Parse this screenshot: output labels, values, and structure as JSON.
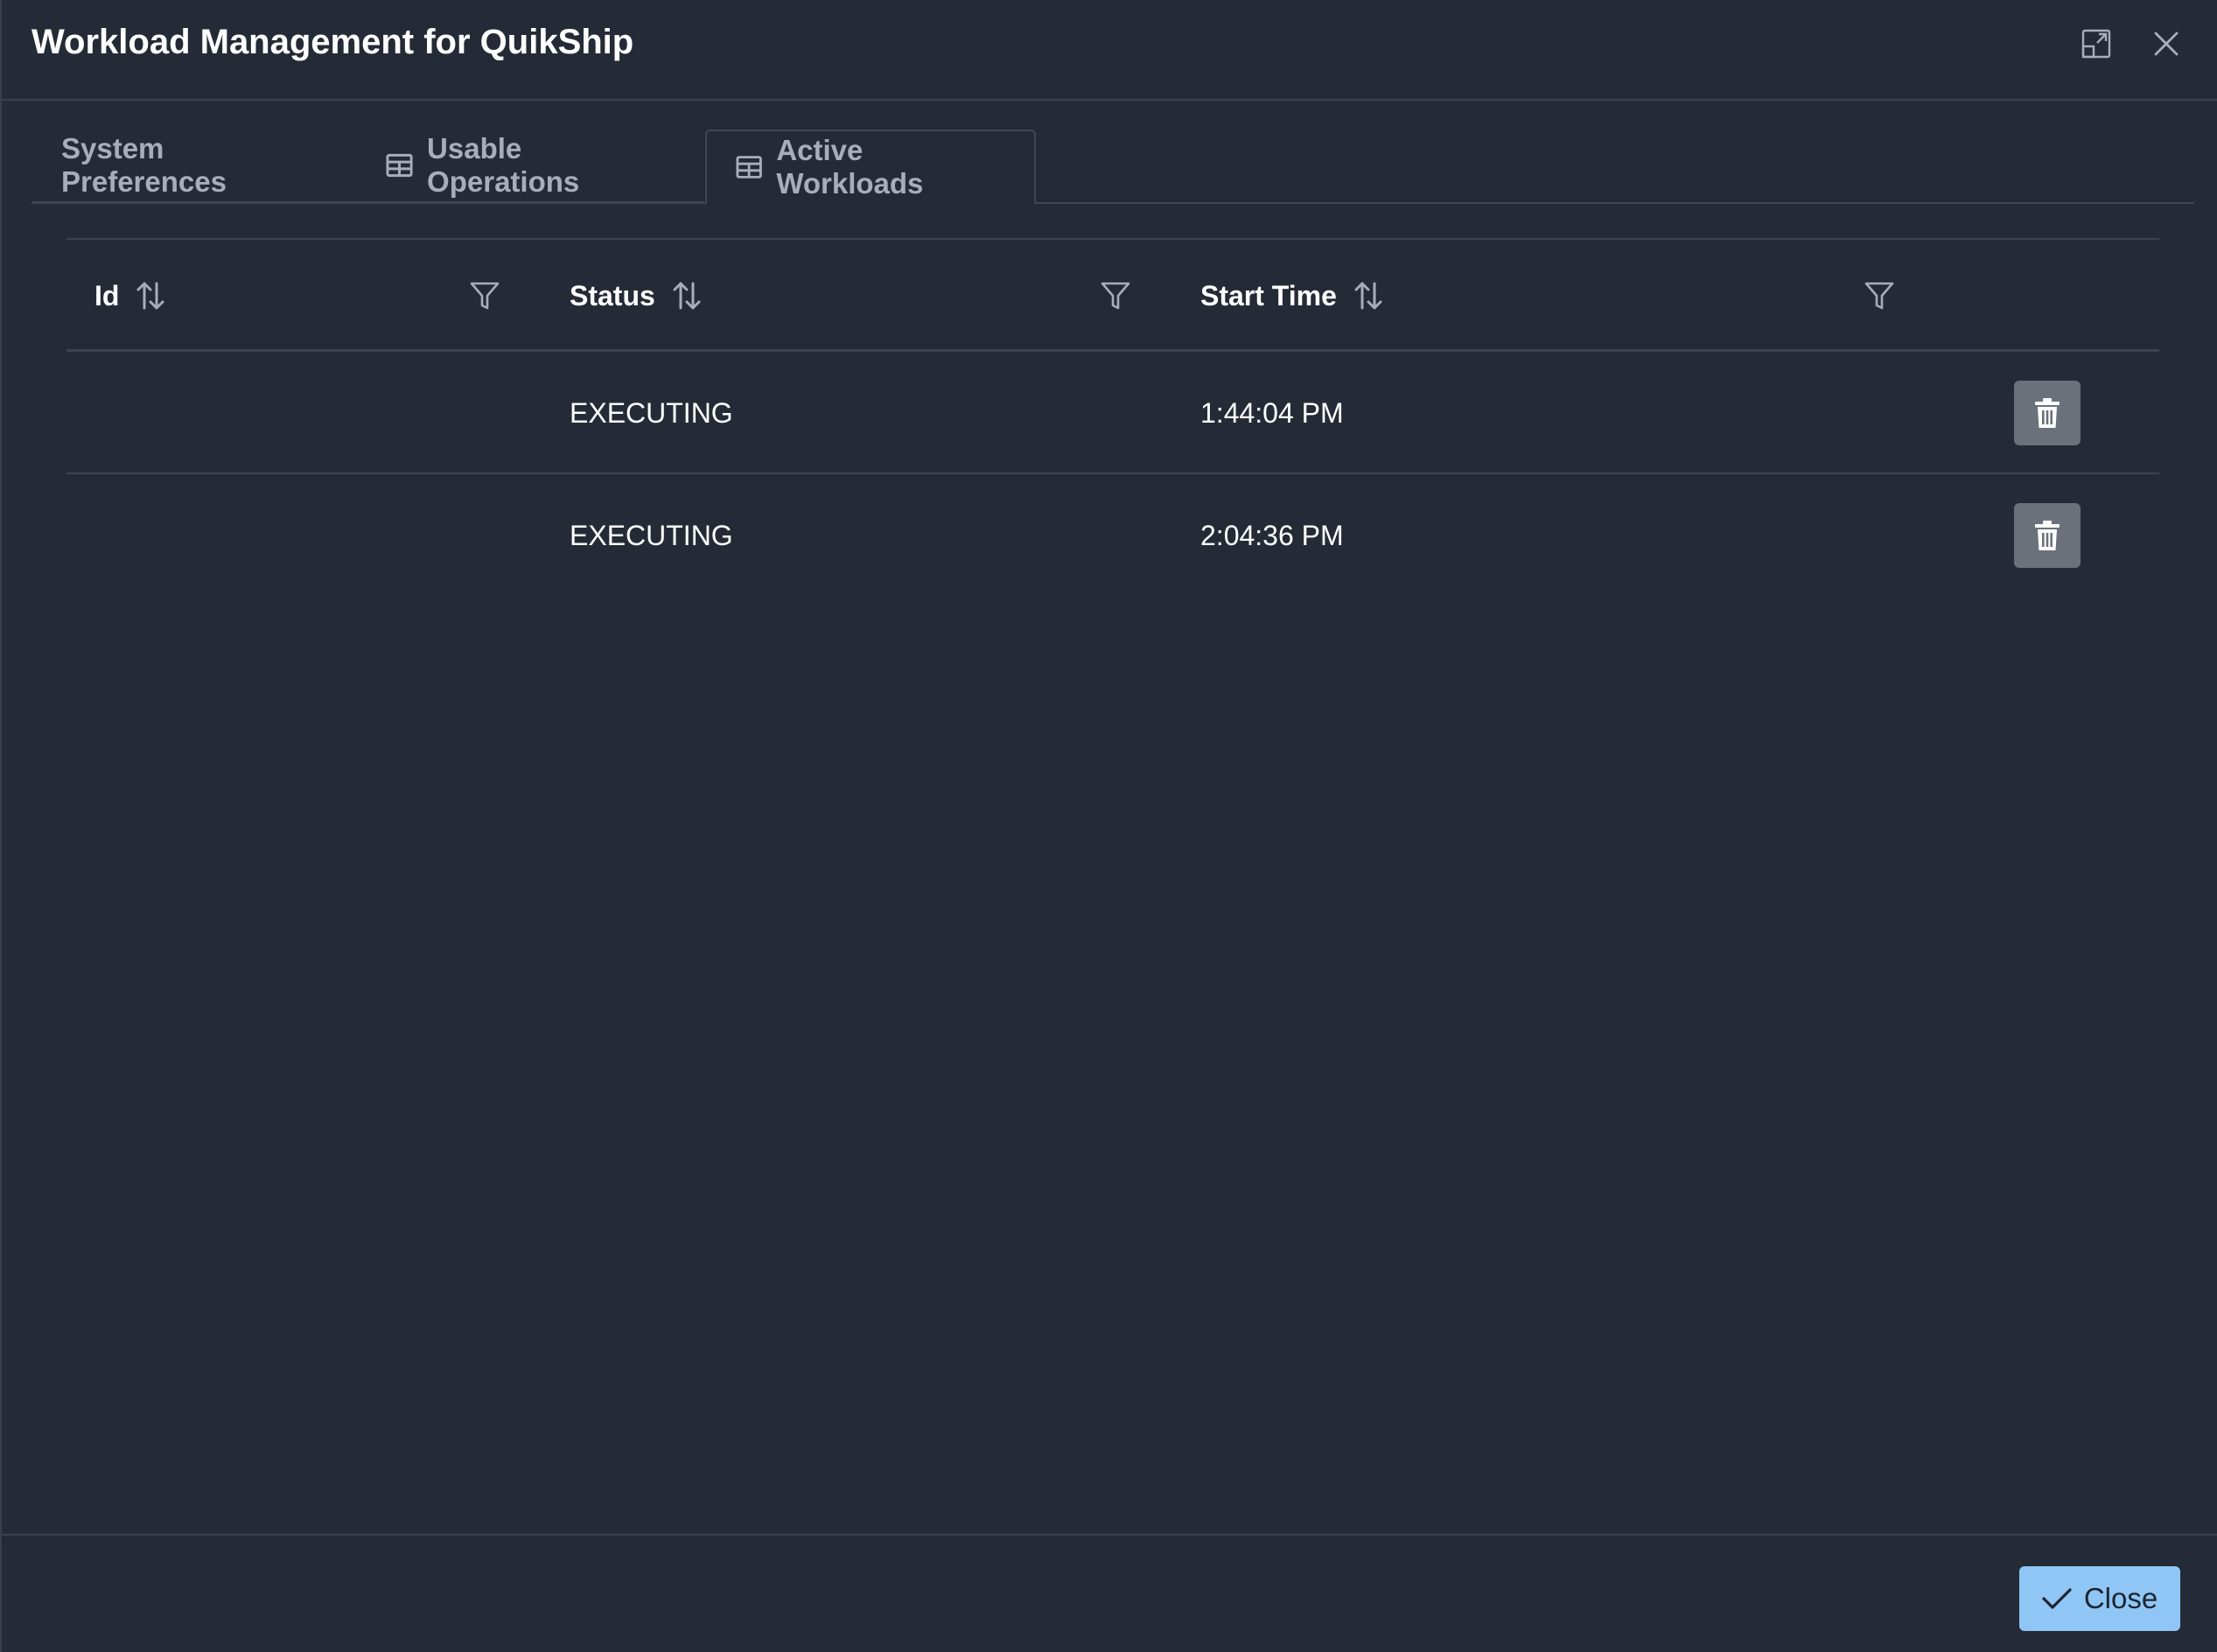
{
  "dialog": {
    "title": "Workload Management for QuikShip",
    "maximize_icon": "window-maximize-icon",
    "close_icon": "close-icon"
  },
  "tabs": [
    {
      "label": "System Preferences",
      "icon": null,
      "active": false
    },
    {
      "label": "Usable Operations",
      "icon": "table-icon",
      "active": false
    },
    {
      "label": "Active Workloads",
      "icon": "table-icon",
      "active": true
    }
  ],
  "table": {
    "columns": [
      {
        "label": "Id",
        "sortable": true,
        "filterable": true
      },
      {
        "label": "Status",
        "sortable": true,
        "filterable": true
      },
      {
        "label": "Start Time",
        "sortable": true,
        "filterable": true
      }
    ],
    "rows": [
      {
        "id": "",
        "status": "EXECUTING",
        "start_time": "1:44:04 PM"
      },
      {
        "id": "",
        "status": "EXECUTING",
        "start_time": "2:04:36 PM"
      }
    ],
    "row_action_icon": "trash-icon"
  },
  "footer": {
    "close_label": "Close",
    "close_icon": "check-icon"
  },
  "colors": {
    "background": "#252b36",
    "primary_button": "#8fc6f5",
    "delete_button": "#6b717b",
    "muted_text": "#a7aeba"
  }
}
